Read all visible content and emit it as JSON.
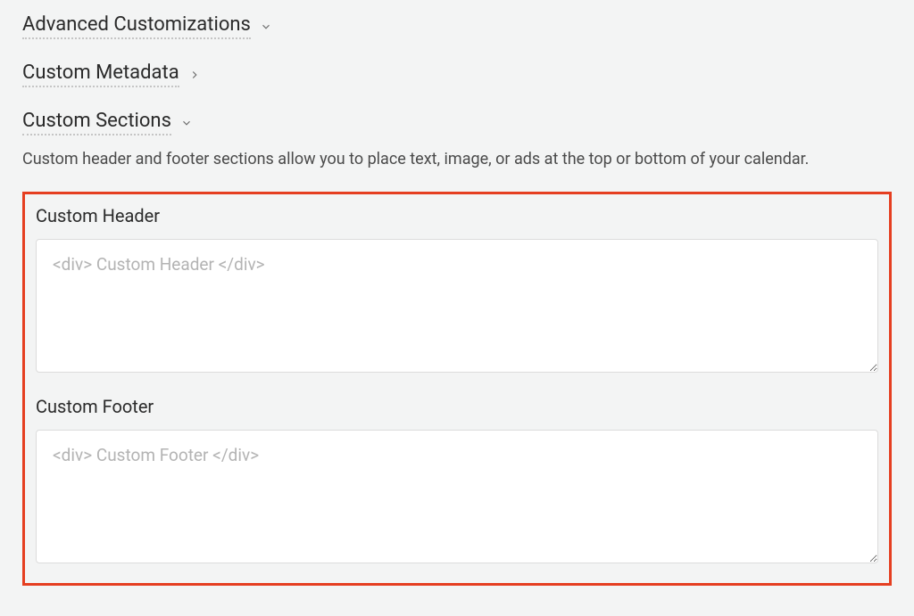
{
  "sections": {
    "advanced": {
      "title": "Advanced Customizations"
    },
    "metadata": {
      "title": "Custom Metadata"
    },
    "customSections": {
      "title": "Custom Sections",
      "description": "Custom header and footer sections allow you to place text, image, or ads at the top or bottom of your calendar."
    }
  },
  "fields": {
    "customHeader": {
      "label": "Custom Header",
      "placeholder": "<div> Custom Header </div>",
      "value": ""
    },
    "customFooter": {
      "label": "Custom Footer",
      "placeholder": "<div> Custom Footer </div>",
      "value": ""
    }
  }
}
